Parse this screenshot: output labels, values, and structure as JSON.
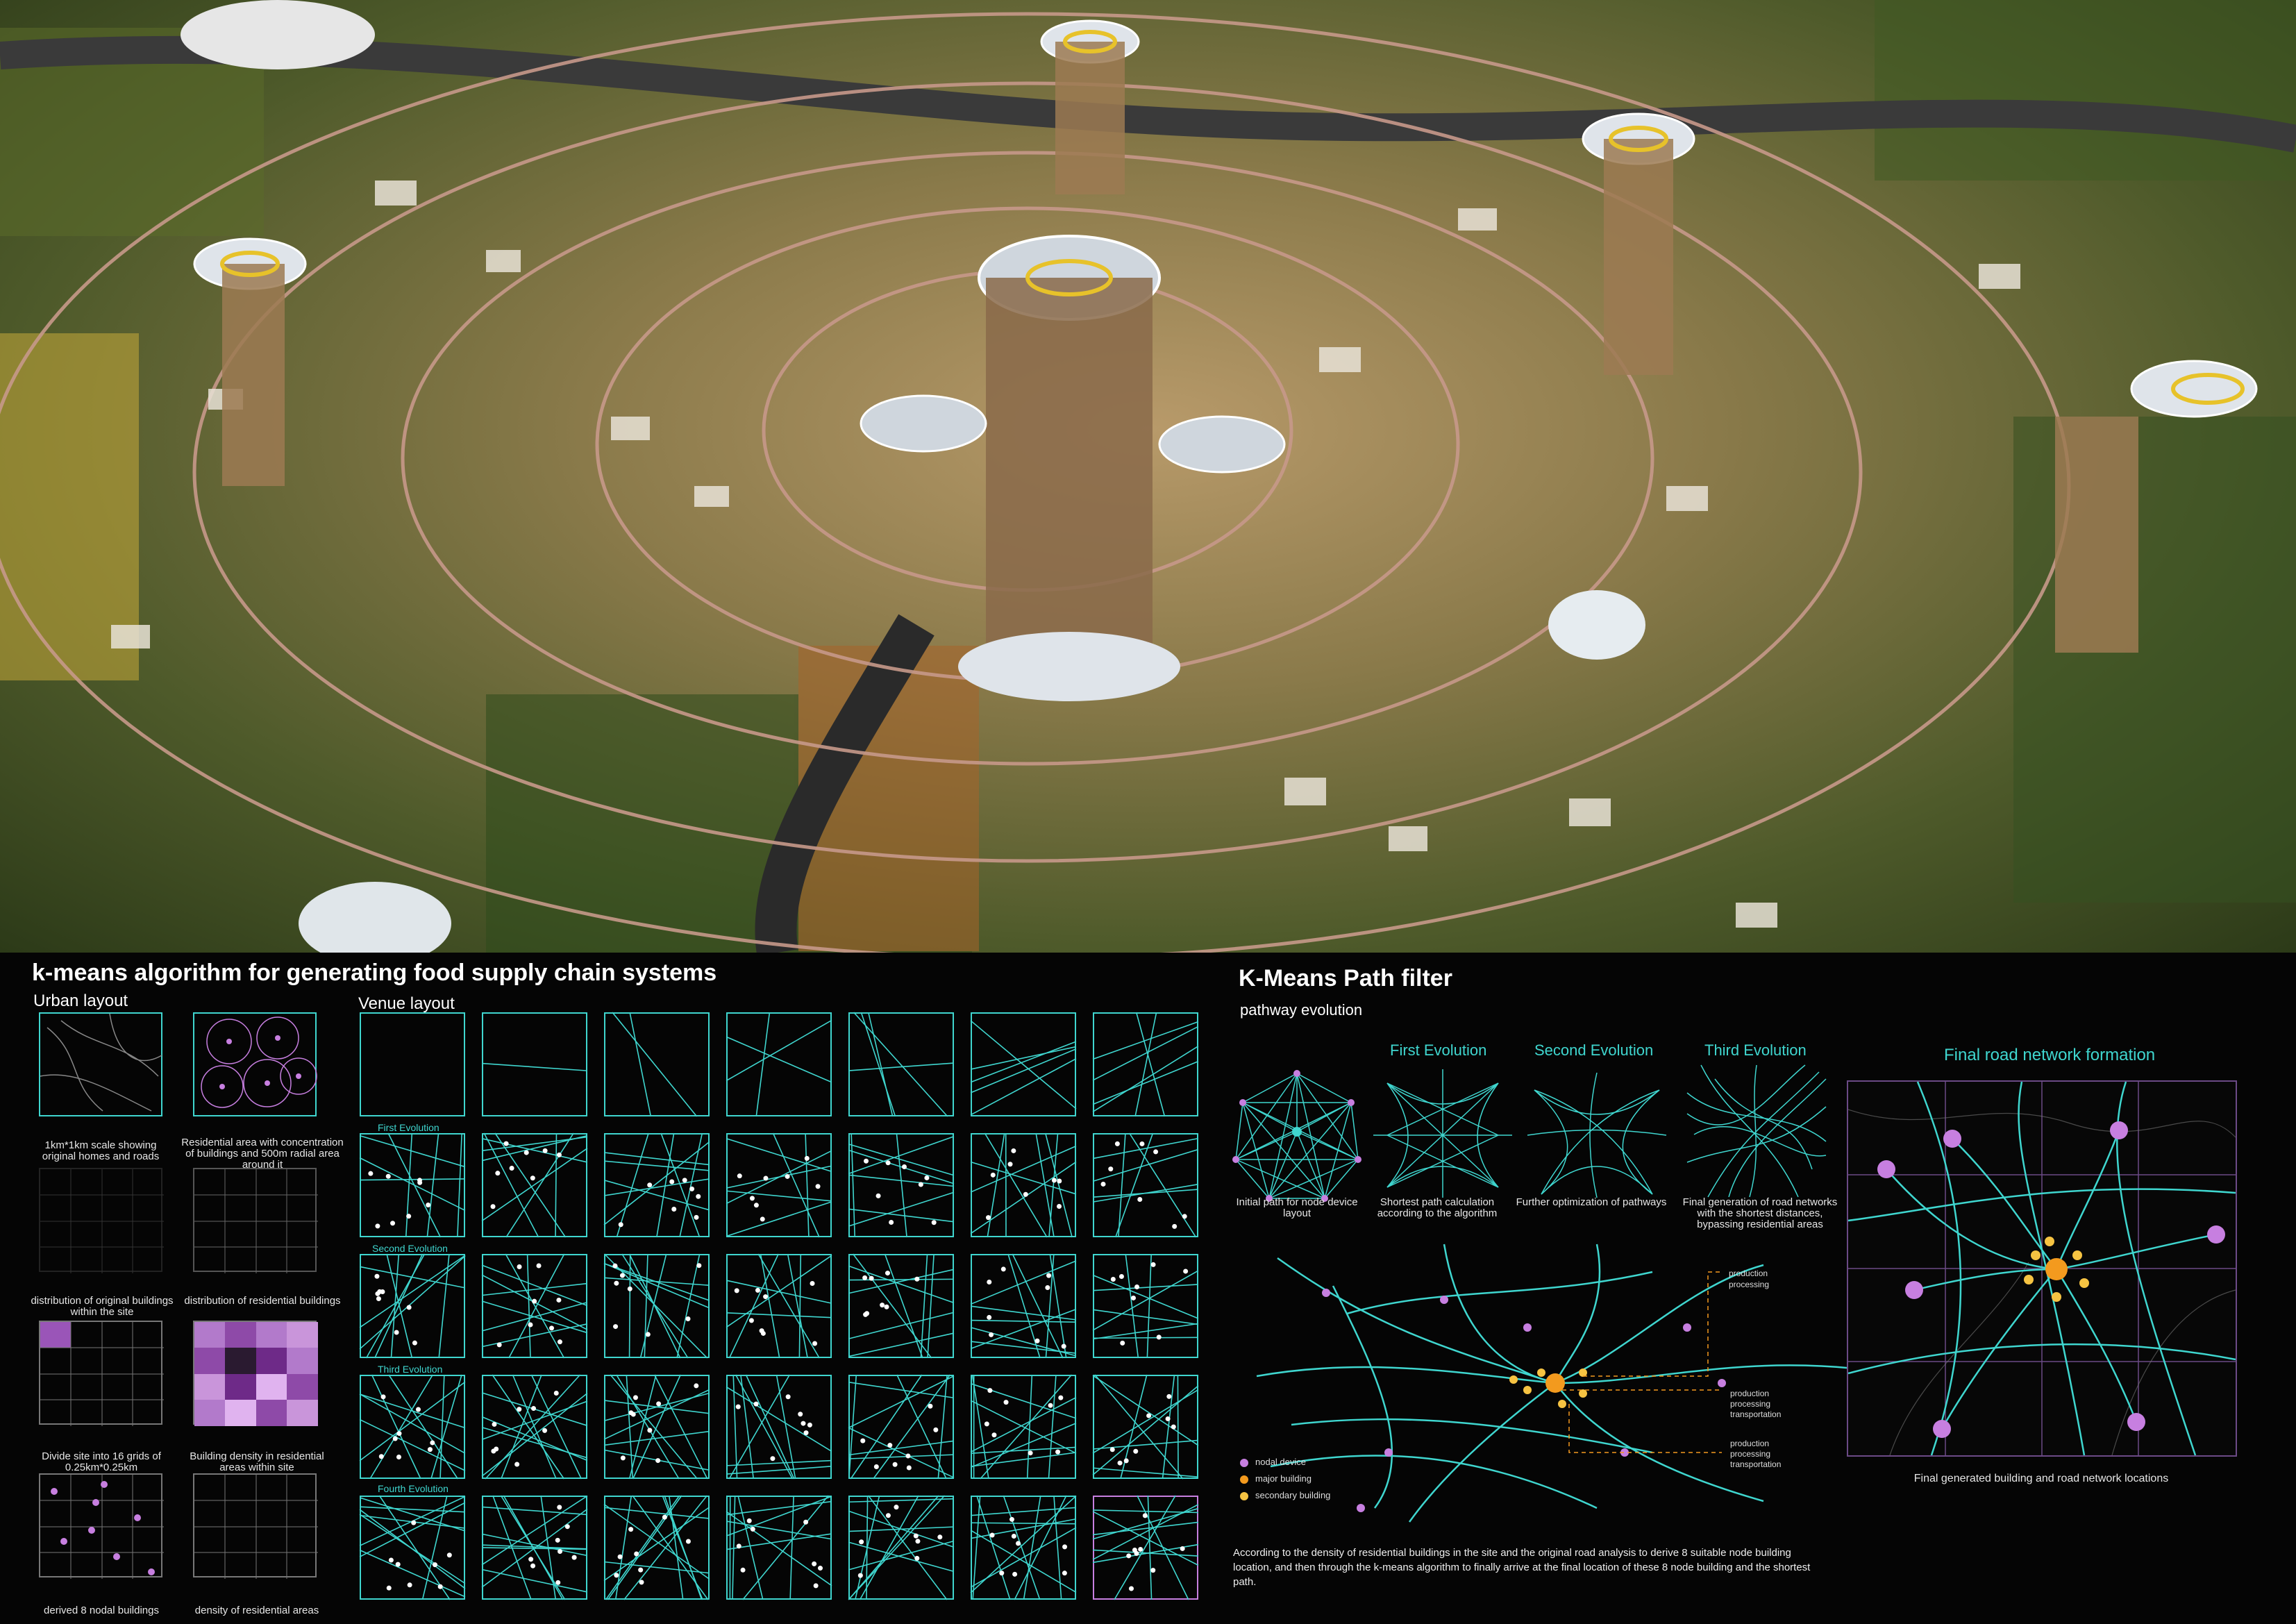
{
  "left": {
    "title": "k-means algorithm for generating food supply chain systems",
    "urban_heading": "Urban layout",
    "venue_heading": "Venue layout",
    "urban_captions": [
      "1km*1km scale showing original homes and roads",
      "Residential area with concentration of buildings and 500m radial area around it",
      "distribution of original buildings within the site",
      "distribution of residential buildings",
      "Divide site into 16 grids of 0.25km*0.25km",
      "Building density in residential areas within site",
      "derived 8 nodal buildings",
      "density of residential areas"
    ],
    "venue_rows": [
      "First Evolution",
      "Second Evolution",
      "Third Evolution",
      "Fourth Evolution"
    ]
  },
  "right": {
    "title": "K-Means Path filter",
    "subtitle": "pathway evolution",
    "evolutions": [
      "First Evolution",
      "Second Evolution",
      "Third Evolution"
    ],
    "final_heading": "Final road network formation",
    "evolution_captions": [
      "Initial path for node device layout",
      "Shortest path calculation according to the algorithm",
      "Further optimization of pathways",
      "Final generation of road networks with the shortest distances, bypassing residential areas"
    ],
    "callouts": {
      "a": [
        "production",
        "processing"
      ],
      "b": [
        "production",
        "processing",
        "transportation"
      ],
      "c": [
        "production",
        "processing",
        "transportation"
      ]
    },
    "legend": [
      "nodal device",
      "major building",
      "secondary building"
    ],
    "description": "According to the density of residential buildings in the site and the original road analysis to derive 8 suitable node building location, and then through the k-means algorithm to finally arrive at the final location of these 8 node building and the shortest path.",
    "final_caption": "Final generated building and road network locations"
  },
  "colors": {
    "teal": "#3fd6cf",
    "purple": "#c77fe0",
    "orange": "#f39a1e",
    "yellow": "#f6c342"
  }
}
